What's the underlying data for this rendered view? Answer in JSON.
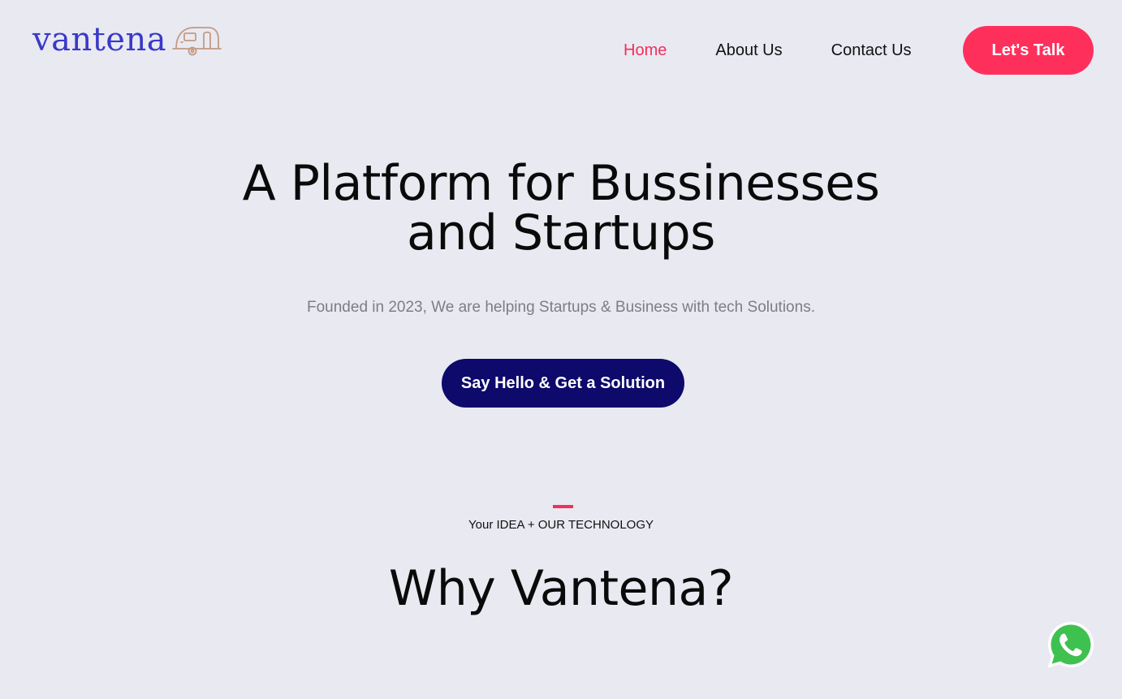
{
  "brand": {
    "name": "vantena",
    "color": "#3a39c9",
    "icon": "camper-trailer-icon",
    "icon_color": "#c49a82"
  },
  "nav": {
    "items": [
      {
        "label": "Home",
        "active": true
      },
      {
        "label": "About Us",
        "active": false
      },
      {
        "label": "Contact Us",
        "active": false
      }
    ],
    "active_color": "#f2305a"
  },
  "header_cta": {
    "label": "Let's Talk",
    "color": "#ff2f5c"
  },
  "hero": {
    "title_line1": "A Platform for Bussinesses",
    "title_line2": "and Startups",
    "subtitle": "Founded in 2023, We are helping Startups & Business with tech Solutions.",
    "cta_label": "Say Hello & Get a Solution",
    "cta_color": "#0d0a6b"
  },
  "section": {
    "tagline": "Your IDEA + OUR TECHNOLOGY",
    "title": "Why Vantena?",
    "accent_color": "#f2305a"
  },
  "floating": {
    "icon": "whatsapp-icon",
    "color": "#3fc14f"
  },
  "background_color": "#e9e9f2"
}
